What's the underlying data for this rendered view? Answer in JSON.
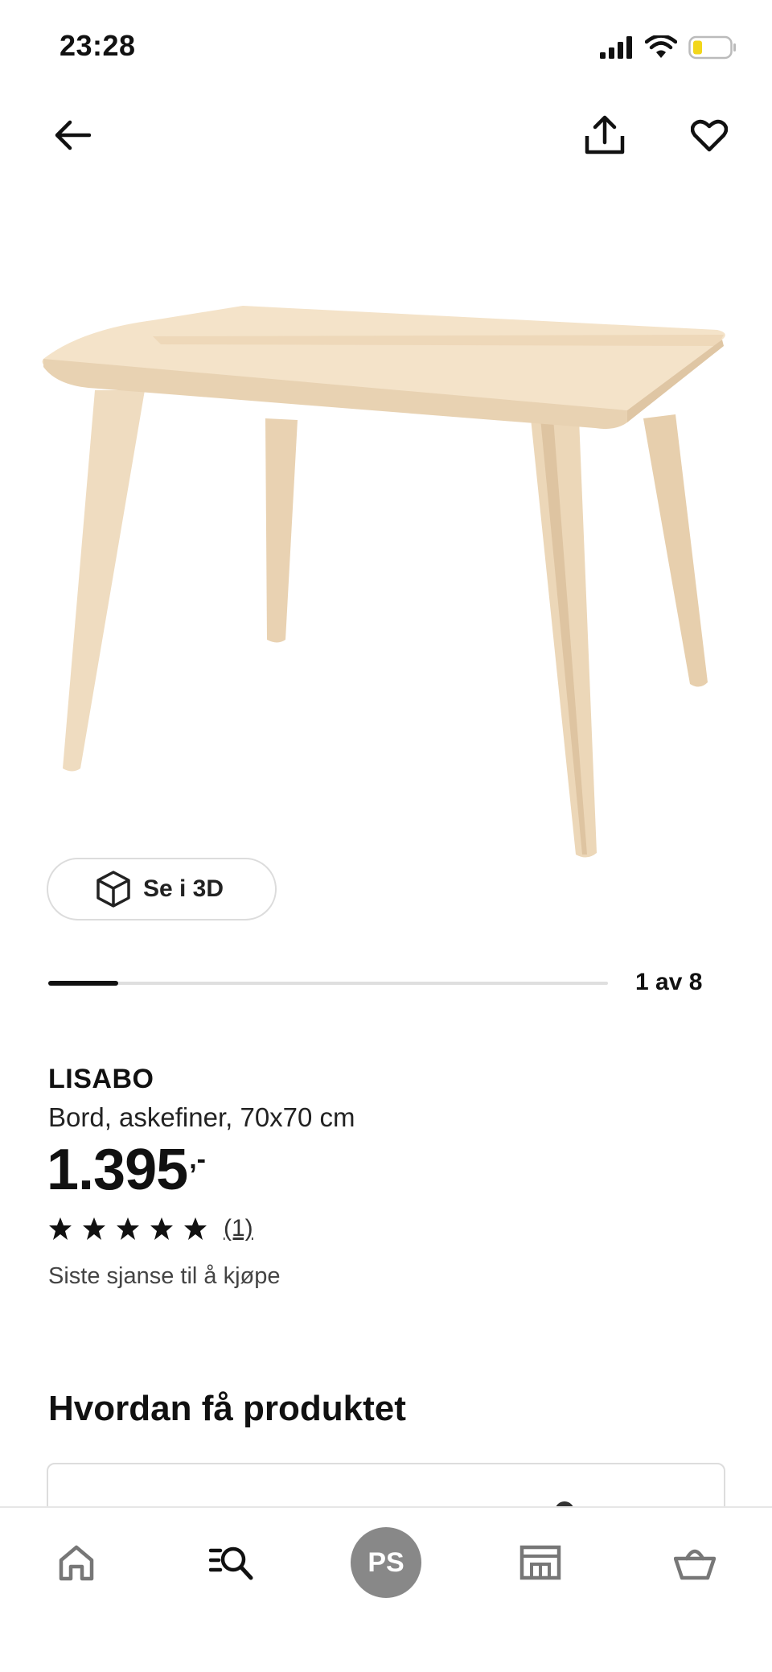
{
  "status_bar": {
    "time": "23:28"
  },
  "product": {
    "name": "LISABO",
    "description": "Bord, askefiner, 70x70 cm",
    "price": "1.395",
    "price_suffix": ",-",
    "rating": 5,
    "review_count": "(1)",
    "availability": "Siste sjanse til å kjøpe"
  },
  "gallery": {
    "view_3d_label": "Se i 3D",
    "counter": "1 av 8",
    "progress": 0.125
  },
  "section": {
    "title": "Hvordan få produktet"
  },
  "bottom_nav": {
    "profile_initials": "PS",
    "items": [
      "home-icon",
      "search-icon",
      "profile-avatar",
      "store-icon",
      "cart-icon"
    ]
  },
  "colors": {
    "text": "#111111",
    "avatar_bg": "#888888",
    "wood_light": "#f3dfc3",
    "wood_mid": "#e8cfae",
    "battery_low": "#f2d61b"
  }
}
